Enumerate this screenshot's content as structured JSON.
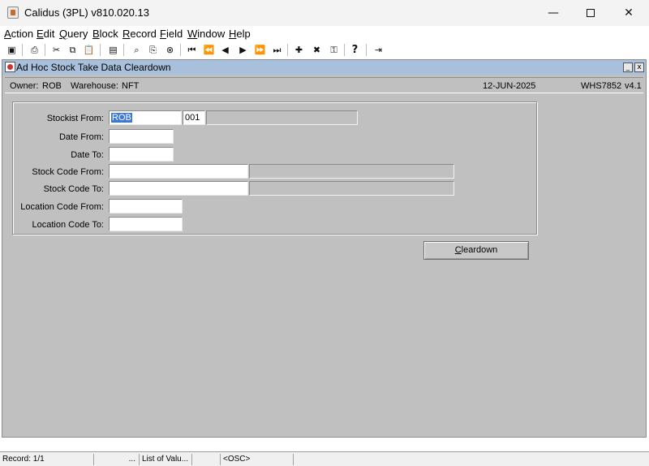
{
  "window": {
    "title": "Calidus (3PL) v810.020.13",
    "min_glyph": "—",
    "close_glyph": "✕"
  },
  "menu": [
    {
      "hot": "A",
      "rest": "ction"
    },
    {
      "hot": "E",
      "rest": "dit"
    },
    {
      "hot": "Q",
      "rest": "uery"
    },
    {
      "hot": "B",
      "rest": "lock"
    },
    {
      "hot": "R",
      "rest": "ecord"
    },
    {
      "hot": "F",
      "rest": "ield"
    },
    {
      "hot": "W",
      "rest": "indow"
    },
    {
      "hot": "H",
      "rest": "elp"
    }
  ],
  "toolbar": {
    "icons": [
      {
        "name": "save-icon",
        "glyph": "▣"
      },
      {
        "name": "print-icon",
        "glyph": "⎙"
      },
      {
        "name": "cut-icon",
        "glyph": "✂"
      },
      {
        "name": "copy-icon",
        "glyph": "⧉"
      },
      {
        "name": "paste-icon",
        "glyph": "📋"
      },
      {
        "name": "clear-field-icon",
        "glyph": "▤"
      },
      {
        "name": "enter-query-icon",
        "glyph": "⌕"
      },
      {
        "name": "execute-query-icon",
        "glyph": "⎘"
      },
      {
        "name": "cancel-query-icon",
        "glyph": "⊗"
      },
      {
        "name": "first-record-icon",
        "glyph": "⏮"
      },
      {
        "name": "previous-block-icon",
        "glyph": "⏪"
      },
      {
        "name": "previous-record-icon",
        "glyph": "◀"
      },
      {
        "name": "next-record-icon",
        "glyph": "▶"
      },
      {
        "name": "next-block-icon",
        "glyph": "⏩"
      },
      {
        "name": "last-record-icon",
        "glyph": "⏭"
      },
      {
        "name": "insert-record-icon",
        "glyph": "✚"
      },
      {
        "name": "remove-record-icon",
        "glyph": "✖"
      },
      {
        "name": "lock-record-icon",
        "glyph": "⚿"
      },
      {
        "name": "help-icon",
        "glyph": "?"
      },
      {
        "name": "exit-icon",
        "glyph": "⇥"
      }
    ]
  },
  "form": {
    "title": "Ad Hoc Stock Take Data Cleardown",
    "min_glyph": "_",
    "close_glyph": "x",
    "owner_label": "Owner:",
    "owner": "ROB",
    "warehouse_label": "Warehouse:",
    "warehouse": "NFT",
    "date": "12-JUN-2025",
    "screen_code": "WHS7852",
    "version": "v4.1",
    "fields": {
      "stockist_from": {
        "label": "Stockist From:",
        "value": "ROB",
        "value2": "001",
        "desc": ""
      },
      "date_from": {
        "label": "Date From:",
        "value": ""
      },
      "date_to": {
        "label": "Date To:",
        "value": ""
      },
      "stock_code_from": {
        "label": "Stock Code From:",
        "value": "",
        "desc": ""
      },
      "stock_code_to": {
        "label": "Stock Code To:",
        "value": "",
        "desc": ""
      },
      "location_code_from": {
        "label": "Location Code From:",
        "value": ""
      },
      "location_code_to": {
        "label": "Location Code To:",
        "value": ""
      }
    },
    "cleardown_button": {
      "hot": "C",
      "rest": "leardown"
    }
  },
  "status": {
    "record": "Record: 1/1",
    "ellipsis": "...",
    "lov": "List of Valu...",
    "osc": "<OSC>"
  }
}
